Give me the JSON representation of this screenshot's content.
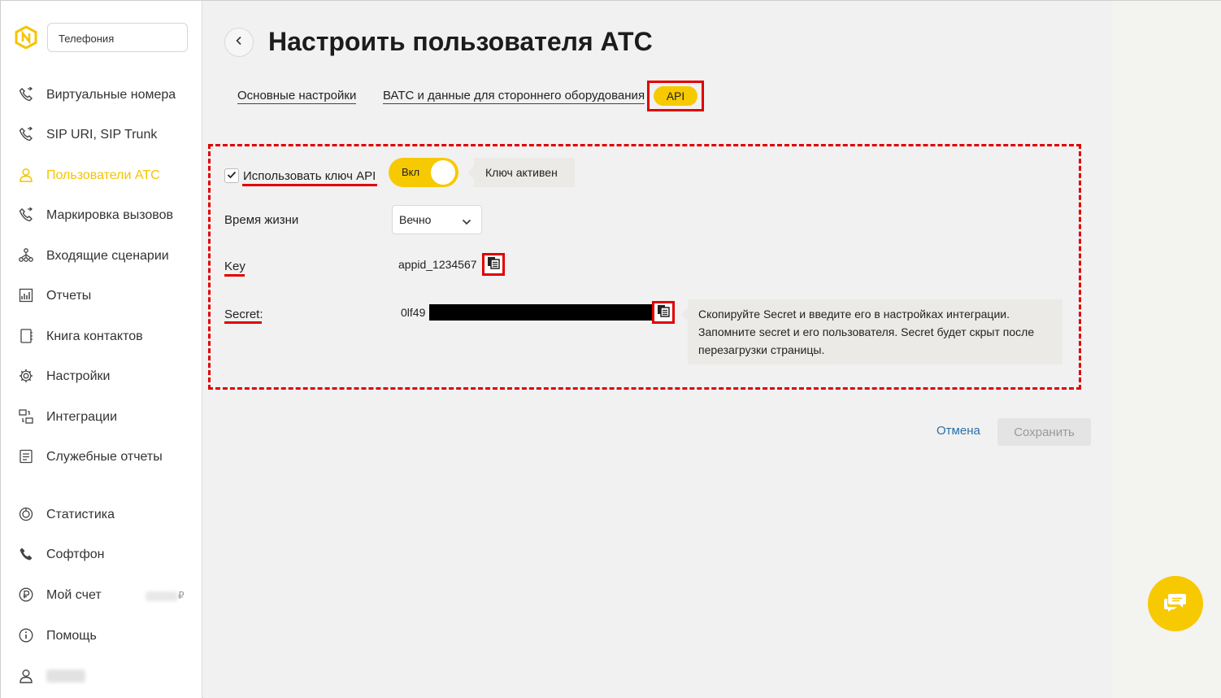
{
  "sidebar": {
    "section_select": "Телефония",
    "items": [
      {
        "label": "Виртуальные номера",
        "icon": "phone-forward-icon"
      },
      {
        "label": "SIP URI, SIP Trunk",
        "icon": "phone-forward-icon"
      },
      {
        "label": "Пользователи АТС",
        "icon": "user-icon",
        "active": true
      },
      {
        "label": "Маркировка вызовов",
        "icon": "phone-forward-icon"
      },
      {
        "label": "Входящие сценарии",
        "icon": "scenario-tree-icon"
      },
      {
        "label": "Отчеты",
        "icon": "report-chart-icon"
      },
      {
        "label": "Книга контактов",
        "icon": "contact-book-icon"
      },
      {
        "label": "Настройки",
        "icon": "gear-icon"
      },
      {
        "label": "Интеграции",
        "icon": "integration-icon"
      },
      {
        "label": "Служебные отчеты",
        "icon": "document-list-icon"
      },
      {
        "label": "Статистика",
        "icon": "statistics-icon"
      },
      {
        "label": "Софтфон",
        "icon": "phone-icon"
      },
      {
        "label": "Мой счет",
        "icon": "ruble-icon",
        "currency": "₽"
      },
      {
        "label": "Помощь",
        "icon": "info-icon"
      }
    ]
  },
  "header": {
    "title": "Настроить пользователя АТС"
  },
  "tabs": [
    {
      "label": "Основные настройки"
    },
    {
      "label": "ВАТС и данные для стороннего оборудования"
    },
    {
      "label": "API",
      "active": true
    }
  ],
  "api": {
    "use_key_label": "Использовать ключ API",
    "use_key_checked": true,
    "toggle_label": "Вкл",
    "toggle_on": true,
    "status_text": "Ключ активен",
    "lifetime_label": "Время жизни",
    "lifetime_value": "Вечно",
    "key_label": "Key",
    "key_value": "appid_1234567",
    "secret_label": "Secret:",
    "secret_value_visible": "0lf49",
    "secret_hint": "Скопируйте Secret и введите его в настройках интеграции. Запомните secret и его пользователя. Secret будет скрыт после перезагрузки страницы."
  },
  "actions": {
    "cancel": "Отмена",
    "save": "Сохранить"
  },
  "colors": {
    "accent": "#f7c900",
    "annotation": "#e10000",
    "link": "#2a6fa8"
  }
}
